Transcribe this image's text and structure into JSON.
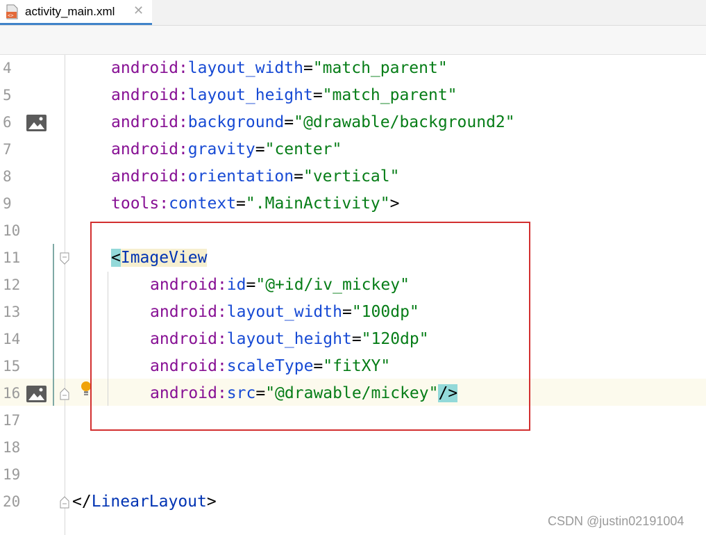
{
  "tab": {
    "label": "activity_main.xml",
    "close": "✕",
    "icon": "xml-file-icon"
  },
  "lines": [
    {
      "num": "4",
      "indent": 2,
      "parts": [
        {
          "t": "android",
          "c": "ns"
        },
        {
          "t": ":",
          "c": "ns"
        },
        {
          "t": "layout_width",
          "c": "attr"
        },
        {
          "t": "=",
          "c": "plain"
        },
        {
          "t": "\"match_parent\"",
          "c": "val"
        }
      ]
    },
    {
      "num": "5",
      "indent": 2,
      "parts": [
        {
          "t": "android",
          "c": "ns"
        },
        {
          "t": ":",
          "c": "ns"
        },
        {
          "t": "layout_height",
          "c": "attr"
        },
        {
          "t": "=",
          "c": "plain"
        },
        {
          "t": "\"match_parent\"",
          "c": "val"
        }
      ]
    },
    {
      "num": "6",
      "indent": 2,
      "gutter_icon": "image-icon",
      "parts": [
        {
          "t": "android",
          "c": "ns"
        },
        {
          "t": ":",
          "c": "ns"
        },
        {
          "t": "background",
          "c": "attr"
        },
        {
          "t": "=",
          "c": "plain"
        },
        {
          "t": "\"@drawable/background2\"",
          "c": "val"
        }
      ]
    },
    {
      "num": "7",
      "indent": 2,
      "parts": [
        {
          "t": "android",
          "c": "ns"
        },
        {
          "t": ":",
          "c": "ns"
        },
        {
          "t": "gravity",
          "c": "attr"
        },
        {
          "t": "=",
          "c": "plain"
        },
        {
          "t": "\"center\"",
          "c": "val"
        }
      ]
    },
    {
      "num": "8",
      "indent": 2,
      "parts": [
        {
          "t": "android",
          "c": "ns"
        },
        {
          "t": ":",
          "c": "ns"
        },
        {
          "t": "orientation",
          "c": "attr"
        },
        {
          "t": "=",
          "c": "plain"
        },
        {
          "t": "\"vertical\"",
          "c": "val"
        }
      ]
    },
    {
      "num": "9",
      "indent": 2,
      "parts": [
        {
          "t": "tools",
          "c": "ns"
        },
        {
          "t": ":",
          "c": "ns"
        },
        {
          "t": "context",
          "c": "attr"
        },
        {
          "t": "=",
          "c": "plain"
        },
        {
          "t": "\".MainActivity\"",
          "c": "val"
        },
        {
          "t": ">",
          "c": "plain"
        }
      ]
    },
    {
      "num": "10",
      "indent": 0,
      "parts": []
    },
    {
      "num": "11",
      "indent": 2,
      "fold": true,
      "parts": [
        {
          "t": "<",
          "c": "plain hl-cyan"
        },
        {
          "t": "ImageView",
          "c": "tag hl-yellow"
        }
      ]
    },
    {
      "num": "12",
      "indent": 4,
      "parts": [
        {
          "t": "android",
          "c": "ns"
        },
        {
          "t": ":",
          "c": "ns"
        },
        {
          "t": "id",
          "c": "attr"
        },
        {
          "t": "=",
          "c": "plain"
        },
        {
          "t": "\"@+id/iv_mickey\"",
          "c": "val"
        }
      ]
    },
    {
      "num": "13",
      "indent": 4,
      "parts": [
        {
          "t": "android",
          "c": "ns"
        },
        {
          "t": ":",
          "c": "ns"
        },
        {
          "t": "layout_width",
          "c": "attr"
        },
        {
          "t": "=",
          "c": "plain"
        },
        {
          "t": "\"100dp\"",
          "c": "val"
        }
      ]
    },
    {
      "num": "14",
      "indent": 4,
      "parts": [
        {
          "t": "android",
          "c": "ns"
        },
        {
          "t": ":",
          "c": "ns"
        },
        {
          "t": "layout_height",
          "c": "attr"
        },
        {
          "t": "=",
          "c": "plain"
        },
        {
          "t": "\"120dp\"",
          "c": "val"
        }
      ]
    },
    {
      "num": "15",
      "indent": 4,
      "parts": [
        {
          "t": "android",
          "c": "ns"
        },
        {
          "t": ":",
          "c": "ns"
        },
        {
          "t": "scaleType",
          "c": "attr"
        },
        {
          "t": "=",
          "c": "plain"
        },
        {
          "t": "\"fitXY\"",
          "c": "val"
        }
      ]
    },
    {
      "num": "16",
      "indent": 4,
      "gutter_icon": "image-icon",
      "fold": true,
      "bulb": true,
      "parts": [
        {
          "t": "android",
          "c": "ns"
        },
        {
          "t": ":",
          "c": "ns"
        },
        {
          "t": "src",
          "c": "attr"
        },
        {
          "t": "=",
          "c": "plain"
        },
        {
          "t": "\"@drawable/mickey\"",
          "c": "val"
        },
        {
          "t": "/>",
          "c": "plain hl-cyan"
        }
      ]
    },
    {
      "num": "17",
      "indent": 0,
      "parts": []
    },
    {
      "num": "18",
      "indent": 0,
      "parts": []
    },
    {
      "num": "19",
      "indent": 0,
      "parts": []
    },
    {
      "num": "20",
      "indent": 0,
      "fold": true,
      "parts": [
        {
          "t": "</",
          "c": "plain"
        },
        {
          "t": "LinearLayout",
          "c": "tag"
        },
        {
          "t": ">",
          "c": "plain"
        }
      ]
    }
  ],
  "watermark": "CSDN @justin02191004",
  "colors": {
    "namespace": "#871094",
    "attribute": "#174ad4",
    "value": "#067d17",
    "tag": "#0033b3",
    "highlight_box": "#d22f2f"
  }
}
